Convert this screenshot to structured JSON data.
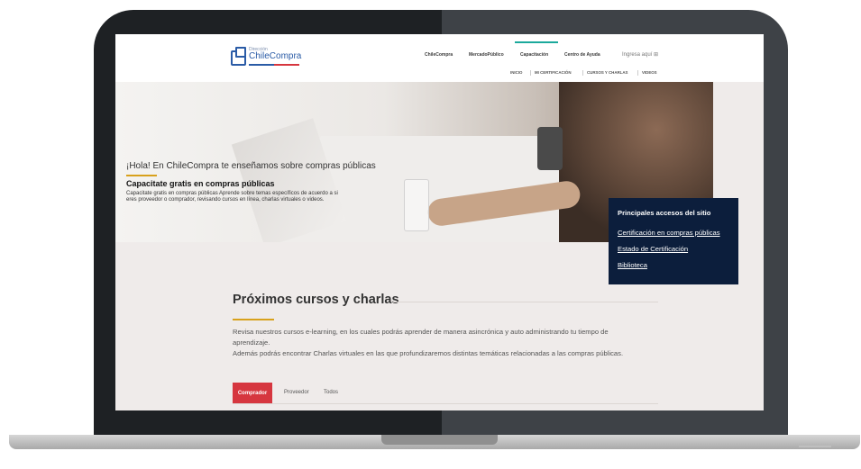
{
  "header": {
    "logo_small": "Dirección",
    "logo_main": "ChileCompra",
    "nav": [
      "ChileCompra",
      "MercadoPúblico",
      "Capacitación",
      "Centro de Ayuda"
    ],
    "login": "Ingresa aquí ⊞",
    "subnav": [
      "INICIO",
      "MI CERTIFICACIÓN",
      "CURSOS Y CHARLAS",
      "VIDEOS"
    ],
    "accent_color": "#1ba99c"
  },
  "hero": {
    "greeting": "¡Hola! En ChileCompra te enseñamos sobre compras públicas",
    "title": "Capacitate gratis en compras públicas",
    "desc_line1": "Capacitate gratis en compras públicas Aprende sobre temas específicos de acuerdo a si",
    "desc_line2": "eres proveedor o comprador, revisando cursos en línea, charlas virtuales o videos."
  },
  "access": {
    "title": "Principales accesos del sitio",
    "links": [
      "Certificación en compras públicas",
      "Estado de Certificación",
      "Biblioteca"
    ],
    "bg_color": "#0c1e3c"
  },
  "section": {
    "title": "Próximos cursos y charlas",
    "p1_line1": "Revisa nuestros cursos e-learning, en los cuales podrás aprender de manera asincrónica y auto administrando tu tiempo de",
    "p1_line2": "aprendizaje.",
    "p2": "Además podrás encontrar Charlas virtuales en las que profundizaremos distintas temáticas relacionadas a las compras públicas."
  },
  "tabs": {
    "active": "Comprador",
    "items": [
      "Proveedor",
      "Todos"
    ],
    "active_color": "#d6363f"
  }
}
